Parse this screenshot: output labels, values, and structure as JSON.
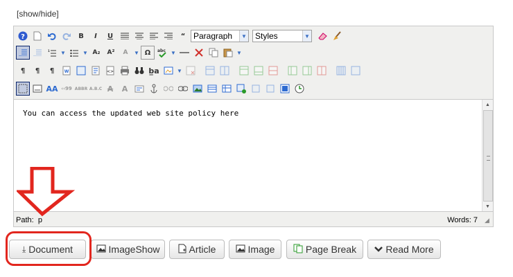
{
  "toggle_label": "[show/hide]",
  "toolbar": {
    "format_select": "Paragraph",
    "styles_select": "Styles",
    "strike_label": "abc"
  },
  "editor": {
    "content_text": "You can access the updated web site policy here",
    "status_path_label": "Path:",
    "status_path_value": "p",
    "status_words": "Words: 7"
  },
  "buttons": [
    {
      "label": "Document",
      "icon": "download-icon"
    },
    {
      "label": "ImageShow",
      "icon": "image-icon"
    },
    {
      "label": "Article",
      "icon": "document-icon"
    },
    {
      "label": "Image",
      "icon": "image-icon"
    },
    {
      "label": "Page Break",
      "icon": "page-break-icon"
    },
    {
      "label": "Read More",
      "icon": "chevron-down-icon"
    }
  ],
  "annotation": {
    "arrow_color": "#e2261e",
    "highlight_color": "#e2261e"
  }
}
